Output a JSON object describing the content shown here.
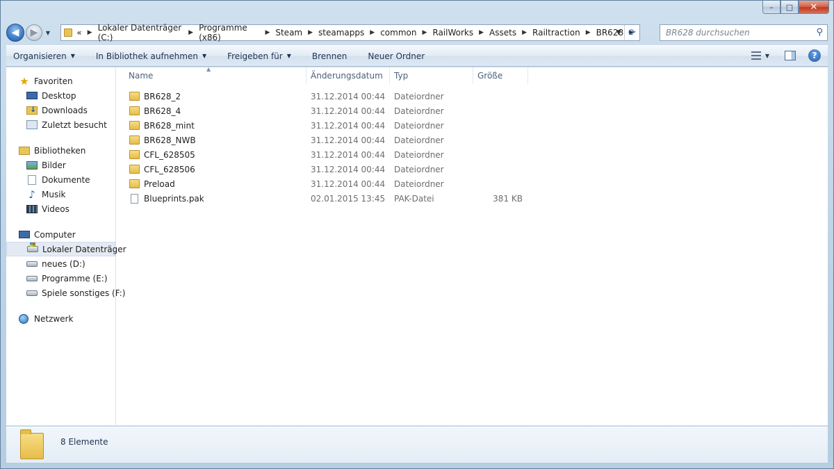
{
  "caption": {
    "minimize": "–",
    "maximize": "□",
    "close": "✕"
  },
  "address": {
    "overflow": "«",
    "crumbs": [
      "Lokaler Datenträger (C:)",
      "Programme (x86)",
      "Steam",
      "steamapps",
      "common",
      "RailWorks",
      "Assets",
      "Railtraction",
      "BR628"
    ]
  },
  "search": {
    "placeholder": "BR628 durchsuchen"
  },
  "toolbar": {
    "organize": "Organisieren",
    "library": "In Bibliothek aufnehmen",
    "share": "Freigeben für",
    "burn": "Brennen",
    "new_folder": "Neuer Ordner"
  },
  "navpane": {
    "favorites": {
      "label": "Favoriten",
      "items": [
        "Desktop",
        "Downloads",
        "Zuletzt besucht"
      ]
    },
    "libraries": {
      "label": "Bibliotheken",
      "items": [
        "Bilder",
        "Dokumente",
        "Musik",
        "Videos"
      ]
    },
    "computer": {
      "label": "Computer",
      "items": [
        "Lokaler Datenträger",
        "neues (D:)",
        "Programme (E:)",
        "Spiele sonstiges (F:)"
      ]
    },
    "network": {
      "label": "Netzwerk"
    }
  },
  "columns": {
    "name": "Name",
    "date": "Änderungsdatum",
    "type": "Typ",
    "size": "Größe"
  },
  "files": [
    {
      "name": "BR628_2",
      "date": "31.12.2014 00:44",
      "type": "Dateiordner",
      "size": ""
    },
    {
      "name": "BR628_4",
      "date": "31.12.2014 00:44",
      "type": "Dateiordner",
      "size": ""
    },
    {
      "name": "BR628_mint",
      "date": "31.12.2014 00:44",
      "type": "Dateiordner",
      "size": ""
    },
    {
      "name": "BR628_NWB",
      "date": "31.12.2014 00:44",
      "type": "Dateiordner",
      "size": ""
    },
    {
      "name": "CFL_628505",
      "date": "31.12.2014 00:44",
      "type": "Dateiordner",
      "size": ""
    },
    {
      "name": "CFL_628506",
      "date": "31.12.2014 00:44",
      "type": "Dateiordner",
      "size": ""
    },
    {
      "name": "Preload",
      "date": "31.12.2014 00:44",
      "type": "Dateiordner",
      "size": ""
    },
    {
      "name": "Blueprints.pak",
      "date": "02.01.2015 13:45",
      "type": "PAK-Datei",
      "size": "381 KB"
    }
  ],
  "status": {
    "count": "8 Elemente"
  }
}
